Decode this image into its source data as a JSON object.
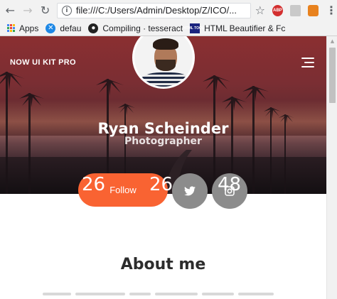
{
  "browser": {
    "back_icon": "arrow-left-icon",
    "forward_icon": "arrow-right-icon",
    "reload_icon": "reload-icon",
    "url": "file:///C:/Users/Admin/Desktop/Z/ICO/...",
    "extensions": [
      {
        "name": "adblock-plus",
        "label": "ABP"
      },
      {
        "name": "pdf-extension",
        "label": ""
      },
      {
        "name": "metamask-fox",
        "label": ""
      }
    ]
  },
  "bookmarks": {
    "items": [
      {
        "label": "Apps"
      },
      {
        "label": "defau"
      },
      {
        "label": "Compiling · tesseract"
      },
      {
        "label": "HTML Beautifier & Fc"
      }
    ],
    "html_icon_text": "HTML TOOLS"
  },
  "page": {
    "brand": "NOW UI KIT PRO",
    "profile": {
      "name": "Ryan Scheinder",
      "role": "Photographer"
    },
    "stats": [
      "26",
      "26",
      "48"
    ],
    "follow_label": "Follow",
    "about_heading": "About me"
  },
  "colors": {
    "accent": "#f96332",
    "icon_button": "#8c8c8c",
    "hero_top": "#8b2f31",
    "hero_bottom": "#241a1f"
  }
}
